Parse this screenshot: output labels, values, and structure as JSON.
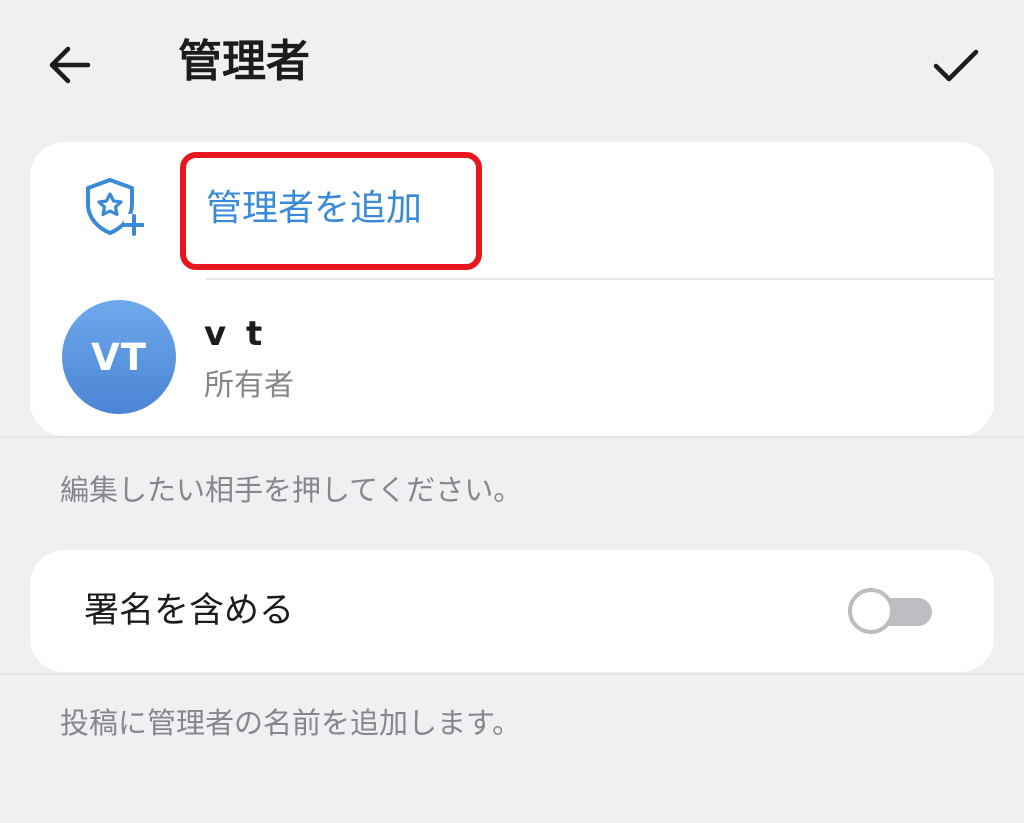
{
  "header": {
    "title": "管理者",
    "back_icon": "arrow-left-icon",
    "confirm_icon": "check-icon"
  },
  "admins_card": {
    "add_label": "管理者を追加",
    "add_icon": "shield-star-add-icon",
    "admins": [
      {
        "initials": "VT",
        "name": "v t",
        "role": "所有者"
      }
    ]
  },
  "admins_hint": "編集したい相手を押してください。",
  "signature": {
    "label": "署名を含める",
    "enabled": false,
    "hint": "投稿に管理者の名前を追加します。"
  },
  "colors": {
    "accent": "#3a8ad8",
    "highlight_box": "#e8161e",
    "background": "#f0f0f3",
    "avatar_top": "#6ea9ec",
    "avatar_bottom": "#4b84d4",
    "toggle_off": "#bdbdc2"
  }
}
